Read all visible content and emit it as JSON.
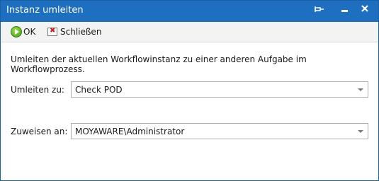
{
  "window": {
    "title": "Instanz umleiten",
    "controls": {
      "pin_icon": "pin-icon",
      "minimize_icon": "minimize-icon",
      "close_icon": "close-icon"
    },
    "title_color": "#1e6fc0"
  },
  "toolbar": {
    "ok_label": "OK",
    "close_label": "Schließen"
  },
  "form": {
    "description": "Umleiten der aktuellen Workflowinstanz zu einer anderen Aufgabe im Workflowprozess.",
    "redirect": {
      "label": "Umleiten zu:",
      "value": "Check POD"
    },
    "assign": {
      "label": "Zuweisen an:",
      "value": "MOYAWARE\\Administrator"
    }
  }
}
